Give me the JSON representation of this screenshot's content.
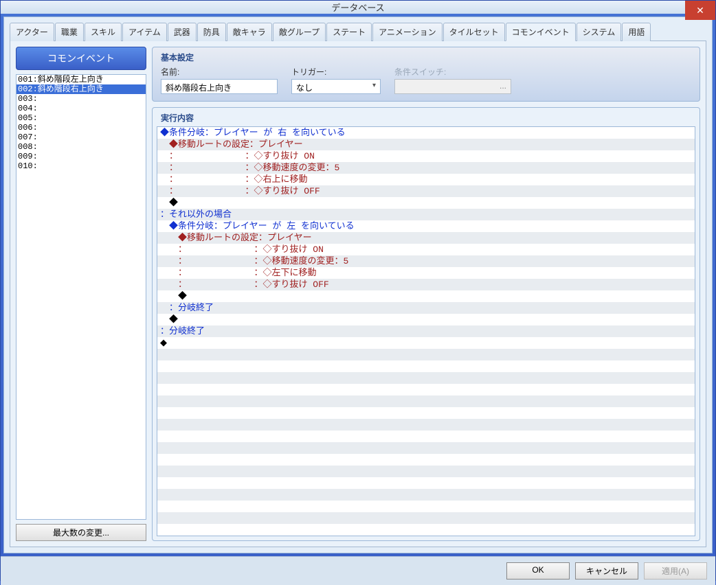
{
  "window": {
    "title": "データベース"
  },
  "tabs": {
    "items": [
      {
        "label": "アクター"
      },
      {
        "label": "職業"
      },
      {
        "label": "スキル"
      },
      {
        "label": "アイテム"
      },
      {
        "label": "武器"
      },
      {
        "label": "防具"
      },
      {
        "label": "敵キャラ"
      },
      {
        "label": "敵グループ"
      },
      {
        "label": "ステート"
      },
      {
        "label": "アニメーション"
      },
      {
        "label": "タイルセット"
      },
      {
        "label": "コモンイベント"
      },
      {
        "label": "システム"
      },
      {
        "label": "用語"
      }
    ],
    "active_index": 11
  },
  "left_panel": {
    "header": "コモンイベント",
    "items": [
      {
        "label": "001:斜め階段左上向き"
      },
      {
        "label": "002:斜め階段右上向き"
      },
      {
        "label": "003:"
      },
      {
        "label": "004:"
      },
      {
        "label": "005:"
      },
      {
        "label": "006:"
      },
      {
        "label": "007:"
      },
      {
        "label": "008:"
      },
      {
        "label": "009:"
      },
      {
        "label": "010:"
      }
    ],
    "selected_index": 1,
    "max_button": "最大数の変更..."
  },
  "basic": {
    "title": "基本設定",
    "name_label": "名前:",
    "name_value": "斜め階段右上向き",
    "trigger_label": "トリガー:",
    "trigger_value": "なし",
    "switch_label": "条件スイッチ:",
    "switch_value": ""
  },
  "exec": {
    "title": "実行内容",
    "commands": [
      {
        "indent": 0,
        "color": "blue",
        "text": "◆条件分岐：プレイヤー が 右 を向いている"
      },
      {
        "indent": 1,
        "color": "red",
        "text": "◆移動ルートの設定：プレイヤー"
      },
      {
        "indent": 1,
        "color": "red",
        "text": "：　　　　　　　　：◇すり抜け ON"
      },
      {
        "indent": 1,
        "color": "red",
        "text": "：　　　　　　　　：◇移動速度の変更：5"
      },
      {
        "indent": 1,
        "color": "red",
        "text": "：　　　　　　　　：◇右上に移動"
      },
      {
        "indent": 1,
        "color": "red",
        "text": "：　　　　　　　　：◇すり抜け OFF"
      },
      {
        "indent": 1,
        "color": "black",
        "text": "◆"
      },
      {
        "indent": 0,
        "color": "blue",
        "text": "：それ以外の場合"
      },
      {
        "indent": 1,
        "color": "blue",
        "text": "◆条件分岐：プレイヤー が 左 を向いている"
      },
      {
        "indent": 2,
        "color": "red",
        "text": "◆移動ルートの設定：プレイヤー"
      },
      {
        "indent": 2,
        "color": "red",
        "text": "：　　　　　　　　：◇すり抜け ON"
      },
      {
        "indent": 2,
        "color": "red",
        "text": "：　　　　　　　　：◇移動速度の変更：5"
      },
      {
        "indent": 2,
        "color": "red",
        "text": "：　　　　　　　　：◇左下に移動"
      },
      {
        "indent": 2,
        "color": "red",
        "text": "：　　　　　　　　：◇すり抜け OFF"
      },
      {
        "indent": 2,
        "color": "black",
        "text": "◆"
      },
      {
        "indent": 1,
        "color": "blue",
        "text": "：分岐終了"
      },
      {
        "indent": 1,
        "color": "black",
        "text": "◆"
      },
      {
        "indent": 0,
        "color": "blue",
        "text": "：分岐終了"
      },
      {
        "indent": 0,
        "color": "black",
        "text": "◆"
      }
    ]
  },
  "buttons": {
    "ok": "OK",
    "cancel": "キャンセル",
    "apply": "適用(A)"
  }
}
